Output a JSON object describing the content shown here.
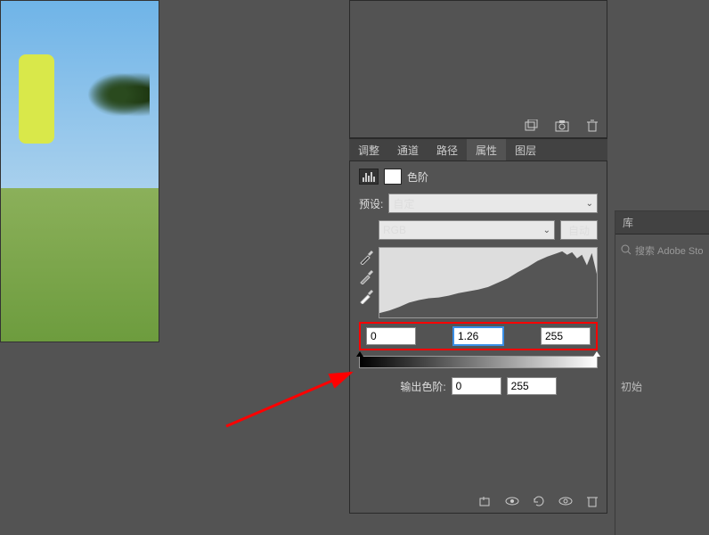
{
  "tabs": {
    "adjust": "调整",
    "channels": "通道",
    "paths": "路径",
    "properties": "属性",
    "layers": "图层"
  },
  "levels": {
    "title": "色阶",
    "preset_label": "预设:",
    "preset_value": "自定",
    "channel_value": "RGB",
    "auto_btn": "自动",
    "input_black": "0",
    "input_mid": "1.26",
    "input_white": "255",
    "output_label": "输出色阶:",
    "output_black": "0",
    "output_white": "255"
  },
  "right": {
    "library_tab": "库",
    "search_placeholder": "搜索 Adobe Sto",
    "init_text": "初始"
  },
  "icons": {
    "new_adjustment": "new-adjustment",
    "camera": "camera",
    "trash": "trash",
    "eyedrop_black": "eyedrop-black",
    "eyedrop_gray": "eyedrop-gray",
    "eyedrop_white": "eyedrop-white",
    "clip": "clip",
    "prev_state": "prev-state",
    "visibility": "visibility",
    "reset": "reset",
    "search": "search"
  }
}
